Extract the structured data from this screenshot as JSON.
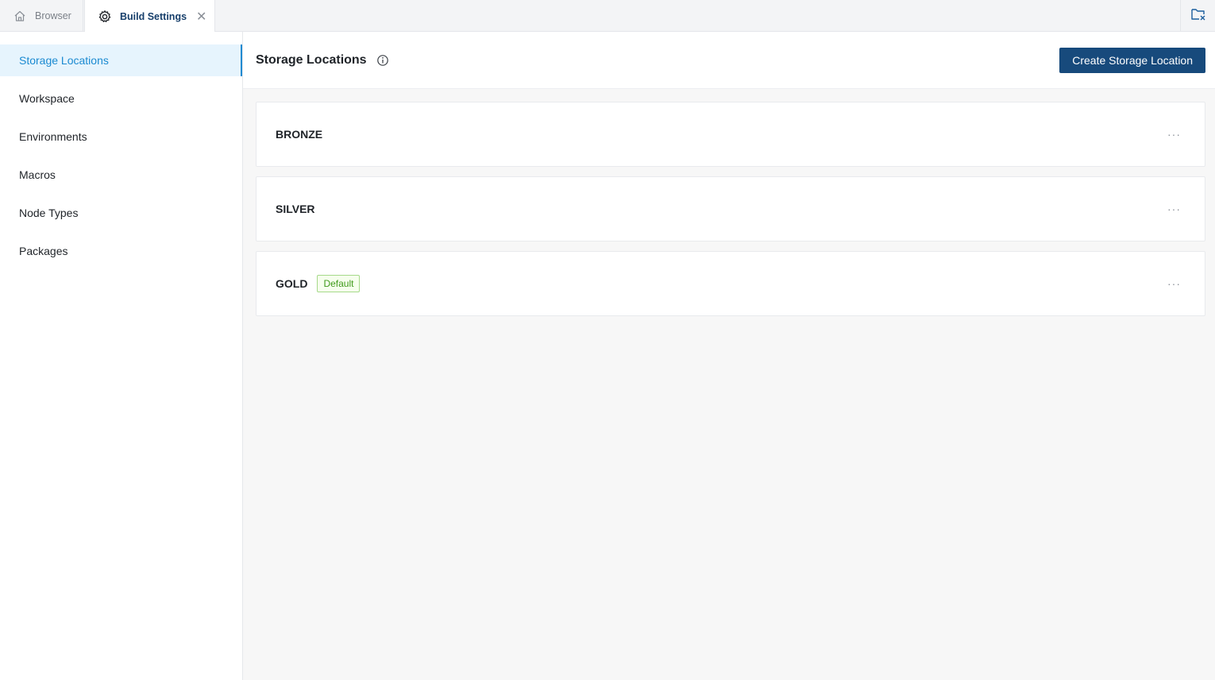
{
  "tabs": [
    {
      "label": "Browser",
      "icon": "home-icon",
      "active": false
    },
    {
      "label": "Build Settings",
      "icon": "gear-icon",
      "active": true,
      "close": "✕"
    }
  ],
  "tabbar": {
    "right_icon": "folder-close-icon"
  },
  "sidebar": {
    "items": [
      {
        "label": "Storage Locations",
        "active": true
      },
      {
        "label": "Workspace"
      },
      {
        "label": "Environments"
      },
      {
        "label": "Macros"
      },
      {
        "label": "Node Types"
      },
      {
        "label": "Packages"
      }
    ]
  },
  "main": {
    "title": "Storage Locations",
    "create_button": "Create Storage Location",
    "locations": [
      {
        "name": "BRONZE",
        "badge": ""
      },
      {
        "name": "SILVER",
        "badge": ""
      },
      {
        "name": "GOLD",
        "badge": "Default"
      }
    ],
    "more_label": "···"
  },
  "colors": {
    "accent": "#1b8ad1",
    "primary_button": "#174a7c",
    "badge_green": "#3f9a1a"
  }
}
